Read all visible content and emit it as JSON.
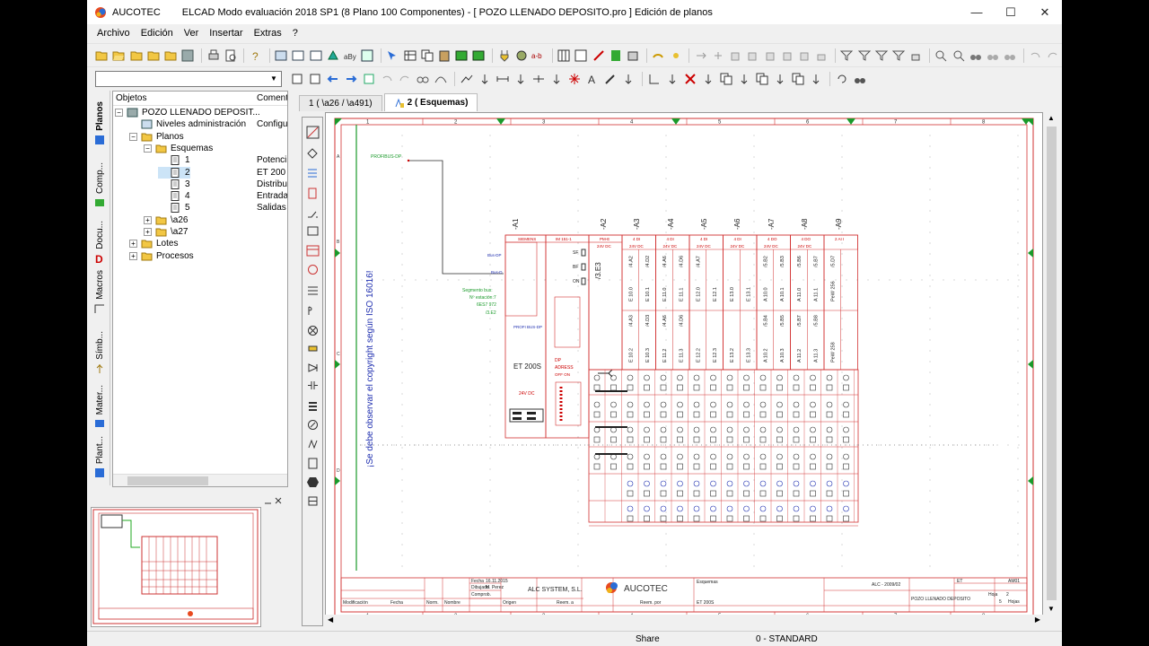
{
  "window": {
    "app_name": "AUCOTEC",
    "title": "ELCAD Modo evaluación 2018 SP1 (8 Plano 100 Componentes) -  [ POZO LLENADO DEPOSITO.pro ]  Edición de planos",
    "minimize": "—",
    "maximize": "☐",
    "close": "✕"
  },
  "menu": [
    "Archivo",
    "Edición",
    "Ver",
    "Insertar",
    "Extras",
    "?"
  ],
  "side_tabs": [
    "Planos",
    "Comp...",
    "Docu...",
    "Macros",
    "Símb...",
    "Mater...",
    "Plant..."
  ],
  "tree": {
    "col_objects": "Objetos",
    "col_comment": "Coment",
    "rows": [
      {
        "label": "POZO LLENADO DEPOSIT...",
        "comment": "",
        "indent": 0,
        "expander": "−",
        "icon": "project-icon"
      },
      {
        "label": "Niveles administración",
        "comment": "Configu",
        "indent": 1,
        "expander": "",
        "icon": "admin-icon"
      },
      {
        "label": "Planos",
        "comment": "",
        "indent": 1,
        "expander": "−",
        "icon": "folder-icon"
      },
      {
        "label": "Esquemas",
        "comment": "",
        "indent": 2,
        "expander": "−",
        "icon": "folder-icon"
      },
      {
        "label": "1",
        "comment": "Potenci",
        "indent": 3,
        "expander": "",
        "icon": "sheet-icon"
      },
      {
        "label": "2",
        "comment": "ET 200",
        "indent": 3,
        "expander": "",
        "icon": "sheet-icon"
      },
      {
        "label": "3",
        "comment": "Distribu",
        "indent": 3,
        "expander": "",
        "icon": "sheet-icon"
      },
      {
        "label": "4",
        "comment": "Entrada",
        "indent": 3,
        "expander": "",
        "icon": "sheet-icon"
      },
      {
        "label": "5",
        "comment": "Salidas",
        "indent": 3,
        "expander": "",
        "icon": "sheet-icon"
      },
      {
        "label": "\\a26",
        "comment": "",
        "indent": 2,
        "expander": "+",
        "icon": "folder-icon"
      },
      {
        "label": "\\a27",
        "comment": "",
        "indent": 2,
        "expander": "+",
        "icon": "folder-icon"
      },
      {
        "label": "Lotes",
        "comment": "",
        "indent": 1,
        "expander": "+",
        "icon": "folder-icon"
      },
      {
        "label": "Procesos",
        "comment": "",
        "indent": 1,
        "expander": "+",
        "icon": "folder-icon"
      }
    ]
  },
  "doc_tabs": [
    {
      "label": "1 ( \\a26 / \\a491)",
      "active": false
    },
    {
      "label": "2 ( Esquemas)",
      "active": true
    }
  ],
  "drawing": {
    "column_numbers": [
      "1",
      "2",
      "3",
      "4",
      "5",
      "6",
      "7",
      "8"
    ],
    "row_letters": [
      "A",
      "B",
      "C",
      "D"
    ],
    "profibus_label": "PROFIBUS-DP",
    "copyright_text": "¡Se debe observar el copyright según ISO 16016!",
    "module_refs": [
      "-A1",
      "-A2",
      "-A3",
      "-A4",
      "-A5",
      "-A6",
      "-A7",
      "-A8",
      "-A9"
    ],
    "module_headers": [
      "SIEMENS",
      "IM 151-1",
      "PM-E",
      "4 DI",
      "4 DI",
      "4 DI",
      "4 DI",
      "4 DO",
      "4 DO",
      "2 AI I"
    ],
    "module_voltages": [
      "24V DC",
      "24V DC",
      "24V DC",
      "24V DC",
      "24V DC",
      "24V DC",
      "24V DC"
    ],
    "et200s_label": "ET 200S",
    "segment_text": [
      "Segmento bus:",
      "Nº estación:7",
      "6ES7 972",
      "/3.E2"
    ],
    "sf_bf_on": [
      "SF",
      "BF",
      "ON"
    ],
    "dp_address": [
      "DP",
      "ADRESS",
      "OFF ON"
    ],
    "busdp_labels": [
      "Bus-DP",
      "Bus-D"
    ],
    "pm_ref": "/3.E3",
    "profi_bus_dp": "PROFI BUS-DP",
    "supply": "24V DC",
    "io_top": [
      "/4.A2",
      "/4.D2",
      "/4.A6",
      "/4.D6",
      "/4.A7",
      "",
      "",
      "",
      "/5.B2",
      "/5.B3",
      "/5.B6",
      "/5.B7",
      "/5.D7"
    ],
    "io_addr1": [
      "E 10.0",
      "E 10.1",
      "E 11.0",
      "E 11.1",
      "E 12.0",
      "E 12.1",
      "E 13.0",
      "E 13.1",
      "A 10.0",
      "A 10.1",
      "A 11.0",
      "A 11.1",
      "PeW 256"
    ],
    "io_mid": [
      "/4.A3",
      "/4.D3",
      "/4.A6",
      "/4.D6",
      "",
      "",
      "",
      "",
      "/5.B4",
      "/5.B5",
      "/5.B7",
      "/5.B8",
      ""
    ],
    "io_addr2": [
      "E 10.2",
      "E 10.3",
      "E 11.2",
      "E 11.3",
      "E 12.2",
      "E 12.3",
      "E 13.2",
      "E 13.3",
      "A 10.2",
      "A 10.3",
      "A 11.2",
      "A 11.3",
      "PeW 258"
    ],
    "title_block": {
      "company": "ALC SYSTEM, S.L.",
      "logo_text": "AUCOTEC",
      "esquemas": "Esquemas",
      "et200s": "ET 200S",
      "doc_number": "ALC - 2009/02",
      "project_name": "POZO LLENADO DEPOSITO",
      "sheet_label": "Hoja",
      "sheet_number": "2",
      "sheets_total": "5",
      "fecha": "Fecha",
      "fecha_val": "16.11.2015",
      "dibujado": "Dibujado",
      "dibujado_val": "M. Perez",
      "comprob": "Comprob.",
      "norm": "Norm.",
      "nombre": "Nombre",
      "modificacion": "Modificación",
      "origen": "Origen",
      "reem_a": "Reem. a",
      "reem_por": "Reem. por",
      "et_label": "ET",
      "am_label": "AM01",
      "hojas_label": "Hojas"
    }
  },
  "status": {
    "share": "Share",
    "standard": "0 - STANDARD"
  },
  "colors": {
    "frame_red": "#d23232",
    "profibus_green": "#1a9a2a",
    "text_blue": "#2030b0",
    "window_bg": "#f0f0f0"
  }
}
